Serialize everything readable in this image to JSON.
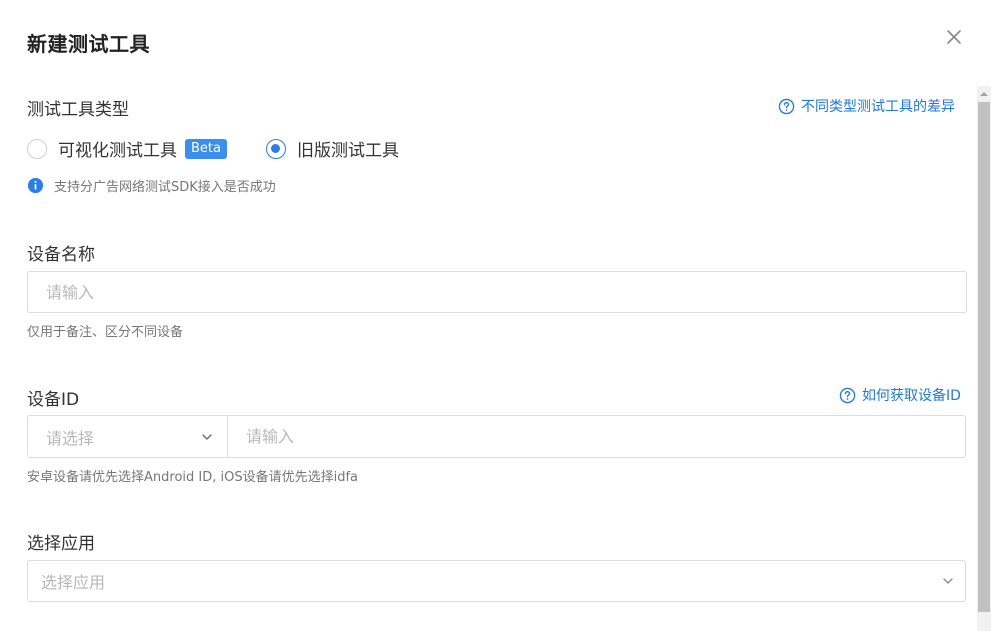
{
  "dialog": {
    "title": "新建测试工具",
    "close_icon": "close-icon"
  },
  "tool_type": {
    "label": "测试工具类型",
    "help_link": "不同类型测试工具的差异",
    "options": [
      {
        "label": "可视化测试工具",
        "badge": "Beta",
        "checked": false
      },
      {
        "label": "旧版测试工具",
        "checked": true
      }
    ],
    "info": "支持分广告网络测试SDK接入是否成功"
  },
  "device_name": {
    "label": "设备名称",
    "placeholder": "请输入",
    "hint": "仅用于备注、区分不同设备"
  },
  "device_id": {
    "label": "设备ID",
    "help_link": "如何获取设备ID",
    "select_placeholder": "请选择",
    "input_placeholder": "请输入",
    "hint": "安卓设备请优先选择Android ID, iOS设备请优先选择idfa"
  },
  "app": {
    "label": "选择应用",
    "placeholder": "选择应用"
  },
  "colors": {
    "accent": "#2b7de9",
    "link": "#1e78e6",
    "badge": "#3a8ef0"
  }
}
